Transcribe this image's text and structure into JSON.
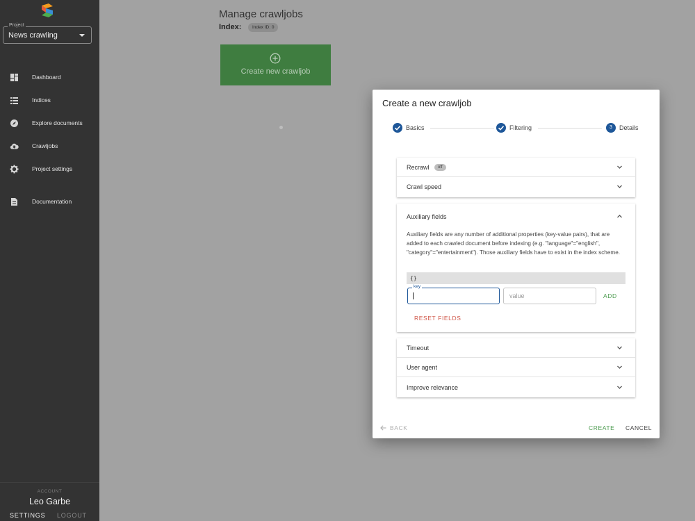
{
  "sidebar": {
    "project_label": "Project",
    "project_value": "News crawling",
    "items": [
      {
        "label": "Dashboard",
        "icon": "dashboard-icon"
      },
      {
        "label": "Indices",
        "icon": "list-icon"
      },
      {
        "label": "Explore documents",
        "icon": "compass-icon"
      },
      {
        "label": "Crawljobs",
        "icon": "cloud-download-icon"
      },
      {
        "label": "Project settings",
        "icon": "gear-icon"
      },
      {
        "label": "Documentation",
        "icon": "document-icon"
      }
    ],
    "account_label": "ACCOUNT",
    "account_name": "Leo Garbe",
    "settings_label": "SETTINGS",
    "logout_label": "LOGOUT"
  },
  "main": {
    "title": "Manage crawljobs",
    "index_label": "Index:",
    "index_chip": "Index ID: 0",
    "create_card_label": "Create new crawljob"
  },
  "dialog": {
    "title": "Create a new crawljob",
    "steps": [
      {
        "label": "Basics",
        "state": "done"
      },
      {
        "label": "Filtering",
        "state": "done"
      },
      {
        "label": "Details",
        "state": "active",
        "number": "3"
      }
    ],
    "recrawl_label": "Recrawl",
    "recrawl_chip": "off",
    "crawl_speed_label": "Crawl speed",
    "aux": {
      "title": "Auxiliary fields",
      "description": "Auxiliary fields are any number of additional properties (key-value pairs), that are added to each crawled document before indexing (e.g. \"language\"=\"english\", \"category\"=\"entertainment\"). Those auxiliary fields have to exist in the index scheme.",
      "json": "{}",
      "key_label": "key",
      "key_value": "",
      "value_placeholder": "value",
      "add_label": "ADD",
      "reset_label": "RESET FIELDS"
    },
    "more_sections": [
      "Timeout",
      "User agent",
      "Improve relevance"
    ],
    "back_label": "BACK",
    "create_label": "CREATE",
    "cancel_label": "CANCEL"
  },
  "colors": {
    "accent_blue": "#1e5799",
    "success_green": "#4a9a4d",
    "danger_red": "#d0584a",
    "sidebar_bg": "#333333"
  }
}
